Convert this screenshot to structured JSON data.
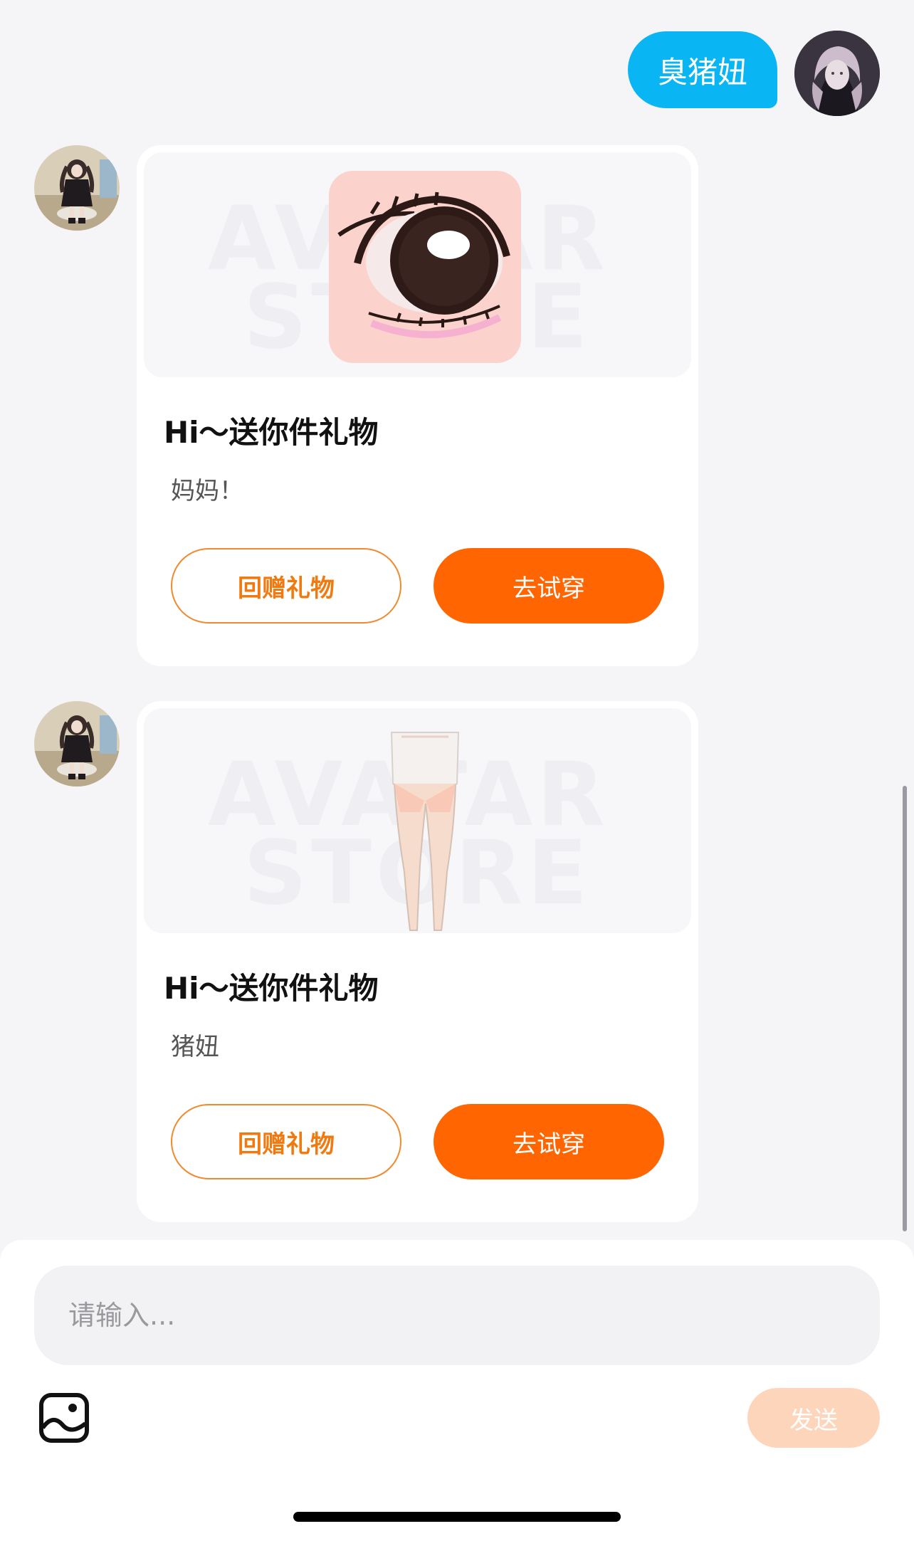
{
  "outgoing_message": {
    "text": "臭猪妞"
  },
  "gifts": [
    {
      "title": "Hi～送你件礼物",
      "note": "妈妈！",
      "return_gift_label": "回赠礼物",
      "try_on_label": "去试穿",
      "item_icon": "eye-makeup-icon"
    },
    {
      "title": "Hi～送你件礼物",
      "note": "猪妞",
      "return_gift_label": "回赠礼物",
      "try_on_label": "去试穿",
      "item_icon": "stockings-icon"
    }
  ],
  "watermark": {
    "line1": "AVATAR",
    "line2": "STORE"
  },
  "input": {
    "placeholder": "请输入..."
  },
  "send_label": "发送",
  "colors": {
    "outgoing_bubble": "#09b6f3",
    "primary_orange": "#ff6602",
    "send_disabled": "#fdd5bb",
    "background": "#f5f4f6"
  }
}
